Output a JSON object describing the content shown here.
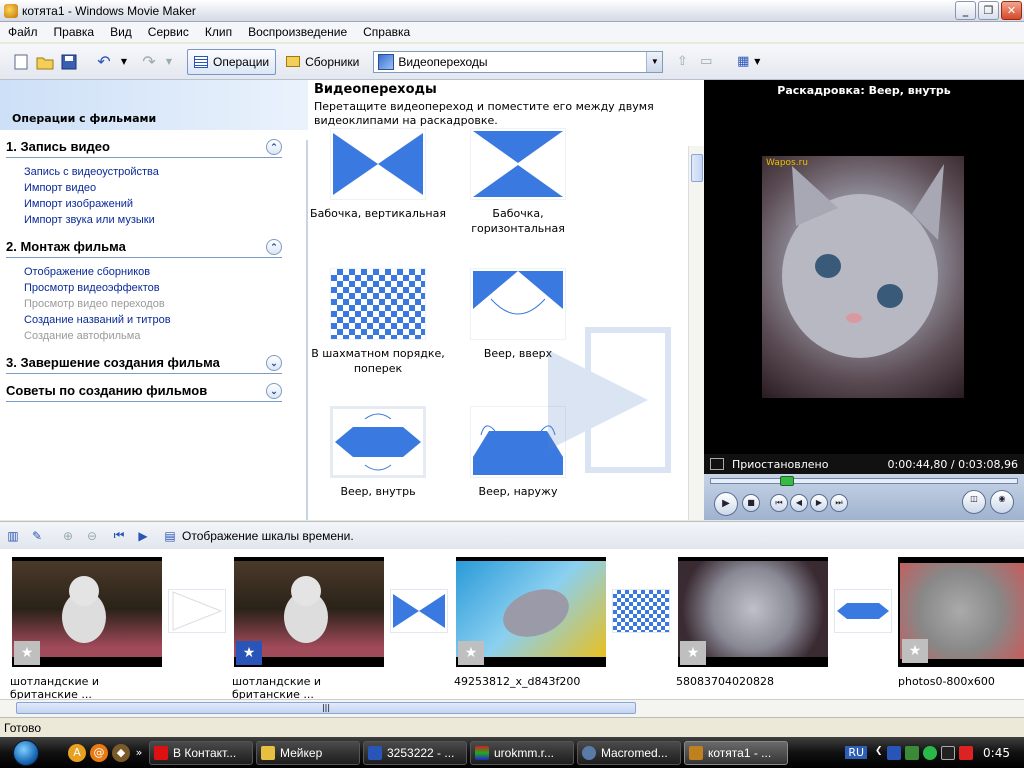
{
  "window": {
    "title": "котята1 - Windows Movie Maker"
  },
  "menu": [
    "Файл",
    "Правка",
    "Вид",
    "Сервис",
    "Клип",
    "Воспроизведение",
    "Справка"
  ],
  "toolbar": {
    "operations_label": "Операции",
    "collections_label": "Сборники",
    "location_value": "Видеопереходы"
  },
  "taskpane": {
    "header": "Операции с фильмами",
    "sections": [
      {
        "title": "1. Запись видео",
        "chevron": "up",
        "links": [
          {
            "label": "Запись с видеоустройства",
            "enabled": true
          },
          {
            "label": "Импорт видео",
            "enabled": true
          },
          {
            "label": "Импорт изображений",
            "enabled": true
          },
          {
            "label": "Импорт звука или музыки",
            "enabled": true
          }
        ]
      },
      {
        "title": "2. Монтаж фильма",
        "chevron": "up",
        "links": [
          {
            "label": "Отображение сборников",
            "enabled": true
          },
          {
            "label": "Просмотр видеоэффектов",
            "enabled": true
          },
          {
            "label": "Просмотр видео переходов",
            "enabled": false
          },
          {
            "label": "Создание названий и титров",
            "enabled": true
          },
          {
            "label": "Создание автофильма",
            "enabled": false
          }
        ]
      },
      {
        "title": "3. Завершение создания фильма",
        "chevron": "down",
        "links": []
      },
      {
        "title": "Советы по созданию фильмов",
        "chevron": "down",
        "links": []
      }
    ]
  },
  "transitions": {
    "heading": "Видеопереходы",
    "description": "Перетащите видеопереход и поместите его между двумя видеоклипами на раскадровке.",
    "items": [
      {
        "label": "Бабочка, вертикальная",
        "icon": "butterfly-vertical"
      },
      {
        "label": "Бабочка, горизонтальная",
        "icon": "butterfly-horizontal"
      },
      {
        "label": "В шахматном порядке, поперек",
        "icon": "checkerboard"
      },
      {
        "label": "Веер, вверх",
        "icon": "fan-up"
      },
      {
        "label": "Веер, внутрь",
        "icon": "fan-in"
      },
      {
        "label": "Веер, наружу",
        "icon": "fan-out"
      }
    ]
  },
  "preview": {
    "title": "Раскадровка: Веер, внутрь",
    "watermark": "Wapos.ru",
    "status": "Приостановлено",
    "time": "0:00:44,80 / 0:03:08,96",
    "seek_fraction": 0.237
  },
  "timeline": {
    "toggle_label": "Отображение шкалы времени."
  },
  "storyboard": {
    "clips": [
      {
        "label": "шотландские и британские ..."
      },
      {
        "label": "шотландские и британские ..."
      },
      {
        "label": "49253812_x_d843f200"
      },
      {
        "label": "58083704020828"
      },
      {
        "label": "photos0-800x600"
      }
    ]
  },
  "statusbar": {
    "text": "Готово"
  },
  "taskbar": {
    "tasks": [
      "В Контакт...",
      "Мейкер",
      "3253222 - ...",
      "urokmm.r...",
      "Macromed...",
      "котята1 - ..."
    ],
    "language": "RU",
    "clock": "0:45"
  },
  "colors": {
    "accent": "#3a6fcf",
    "link": "#0a2a9a",
    "seek_knob": "#3bb84a"
  }
}
